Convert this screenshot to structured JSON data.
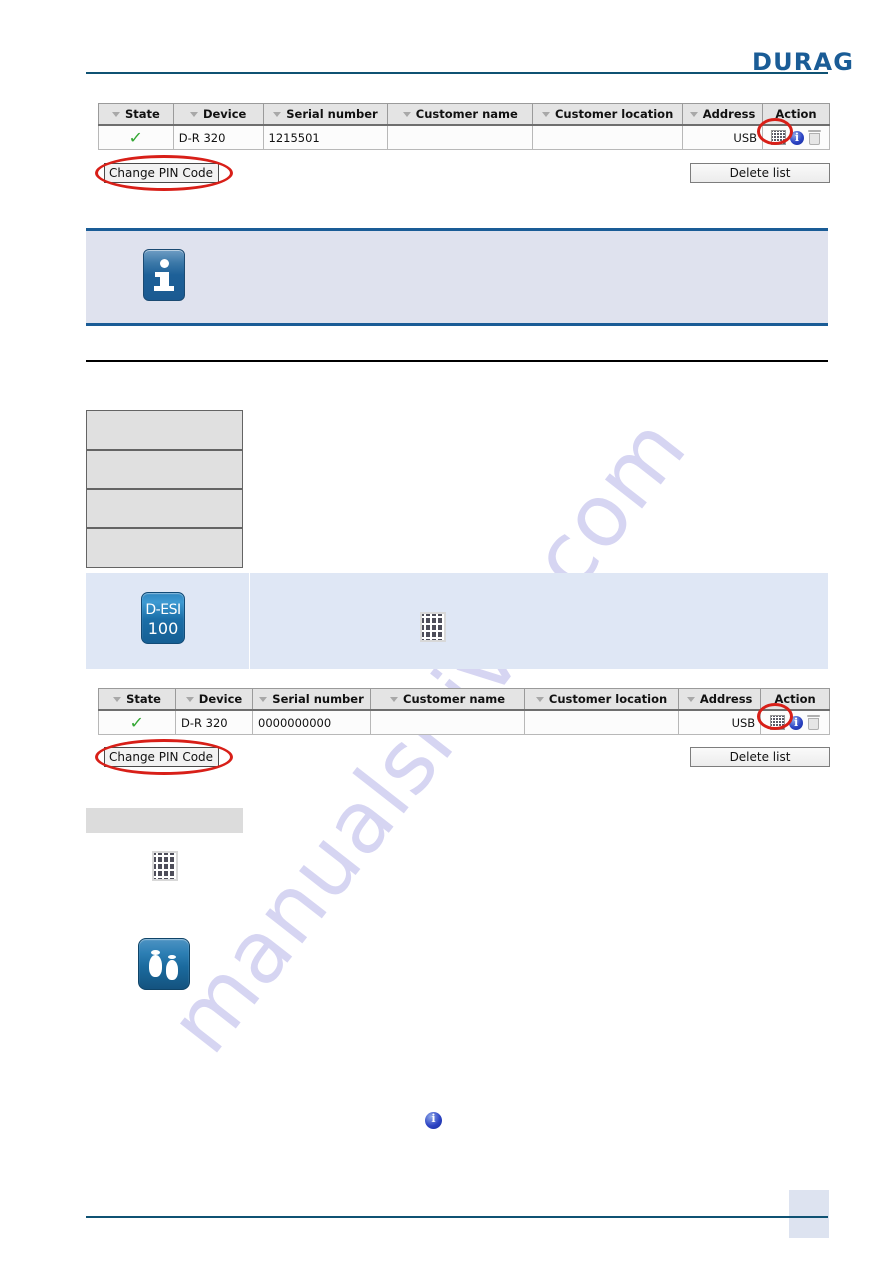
{
  "header": {
    "brand": "DURAG"
  },
  "device_table_1": {
    "columns": [
      "State",
      "Device",
      "Serial number",
      "Customer name",
      "Customer location",
      "Address",
      "Action"
    ],
    "rows": [
      {
        "state": "ok-check",
        "device": "D-R 320",
        "serial_number": "1215501",
        "customer_name": "",
        "customer_location": "",
        "address": "USB",
        "actions": [
          "keypad-icon",
          "info-icon",
          "trash-icon"
        ]
      }
    ],
    "change_pin_label": "Change PIN Code",
    "delete_list_label": "Delete list"
  },
  "device_table_2": {
    "columns": [
      "State",
      "Device",
      "Serial number",
      "Customer name",
      "Customer location",
      "Address",
      "Action"
    ],
    "rows": [
      {
        "state": "ok-check",
        "device": "D-R 320",
        "serial_number": "0000000000",
        "customer_name": "",
        "customer_location": "",
        "address": "USB",
        "actions": [
          "keypad-icon",
          "info-icon",
          "trash-icon"
        ]
      }
    ],
    "change_pin_label": "Change PIN Code",
    "delete_list_label": "Delete list"
  },
  "device_icon": {
    "line1": "D-ESI",
    "line2": "100"
  },
  "watermark": {
    "text": "manualshive.com"
  },
  "colors": {
    "brand_blue": "#1a5c96",
    "rule_blue": "#0f5273",
    "annotation_red": "#d81f18",
    "info_panel_bg": "#dfe2ee",
    "blue_panel_bg": "#dfe7f5",
    "check_green": "#35a835",
    "watermark_purple": "#c9c7ee"
  }
}
